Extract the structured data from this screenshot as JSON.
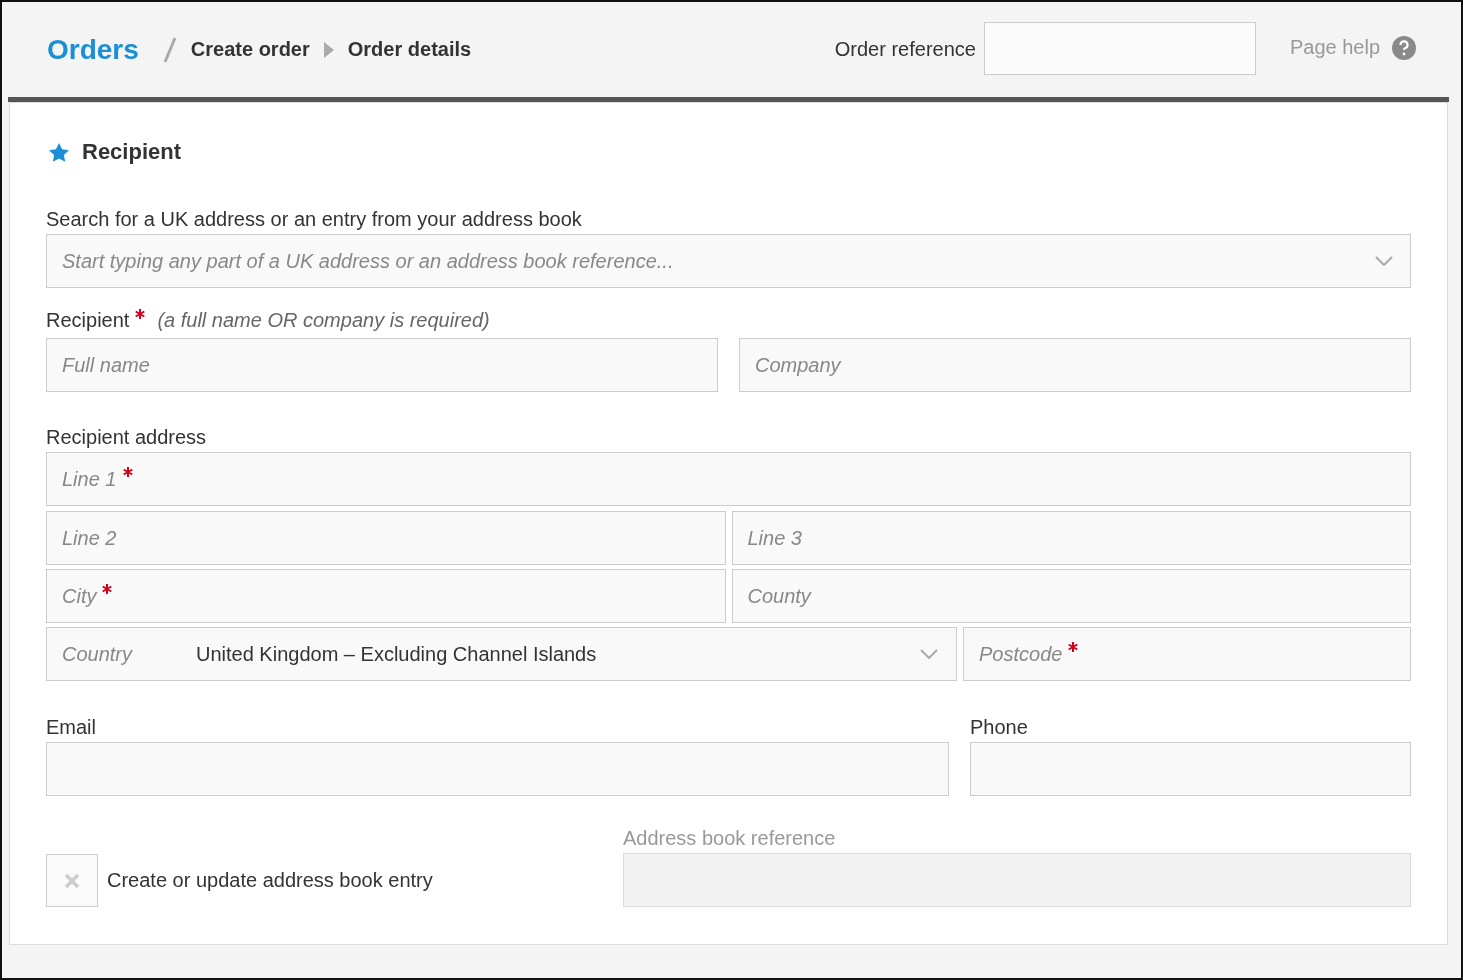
{
  "header": {
    "breadcrumb": [
      {
        "label": "Orders",
        "kind": "root"
      },
      {
        "label": "Create order",
        "kind": "step"
      },
      {
        "label": "Order details",
        "kind": "step"
      }
    ],
    "order_reference": {
      "label": "Order reference"
    },
    "page_help": {
      "label": "Page help"
    }
  },
  "section": {
    "title": "Recipient",
    "search": {
      "label": "Search for a UK address or an entry from your address book",
      "placeholder": "Start typing any part of a UK address or an address book reference..."
    },
    "recipient": {
      "label": "Recipient",
      "required": true,
      "hint": "(a full name OR company is required)",
      "fields": [
        {
          "placeholder": "Full name",
          "required": false
        },
        {
          "placeholder": "Company",
          "required": false
        }
      ]
    },
    "address": {
      "label": "Recipient address",
      "rows": [
        [
          {
            "kind": "text",
            "placeholder": "Line 1",
            "required": true
          }
        ],
        [
          {
            "kind": "text",
            "placeholder": "Line 2",
            "required": false
          },
          {
            "kind": "text",
            "placeholder": "Line 3",
            "required": false
          }
        ],
        [
          {
            "kind": "text",
            "placeholder": "City",
            "required": true
          },
          {
            "kind": "text",
            "placeholder": "County",
            "required": false
          }
        ],
        [
          {
            "kind": "select",
            "label": "Country",
            "value": "United Kingdom – Excluding Channel Islands"
          },
          {
            "kind": "text",
            "placeholder": "Postcode",
            "required": true
          }
        ]
      ]
    },
    "email": {
      "label": "Email"
    },
    "phone": {
      "label": "Phone"
    },
    "address_book": {
      "checkbox": {
        "label": "Create or update address book entry",
        "checked": false
      },
      "reference": {
        "label": "Address book reference",
        "disabled": true
      }
    }
  }
}
